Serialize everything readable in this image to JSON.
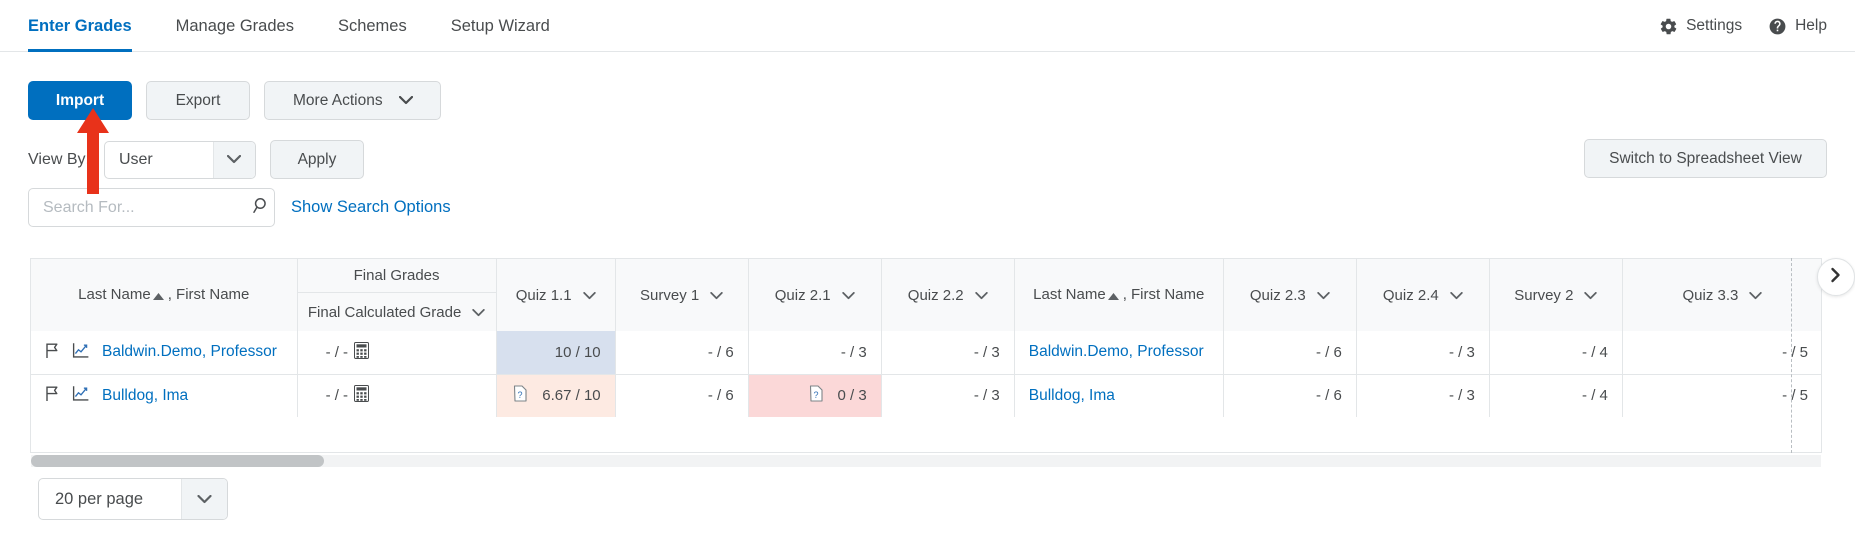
{
  "nav": {
    "tabs": [
      {
        "label": "Enter Grades",
        "active": true
      },
      {
        "label": "Manage Grades",
        "active": false
      },
      {
        "label": "Schemes",
        "active": false
      },
      {
        "label": "Setup Wizard",
        "active": false
      }
    ],
    "settings_label": "Settings",
    "help_label": "Help",
    "settings_icon": "gear-icon",
    "help_icon": "help-circle-icon",
    "active_color": "#006fbf"
  },
  "toolbar": {
    "import_label": "Import",
    "export_label": "Export",
    "more_actions_label": "More Actions",
    "primary_color": "#006fbf"
  },
  "viewby": {
    "label": "View By:",
    "selected": "User",
    "apply_label": "Apply",
    "spreadsheet_label": "Switch to Spreadsheet View"
  },
  "search": {
    "value": "",
    "placeholder": "Search For...",
    "icon": "search-icon",
    "show_options_label": "Show Search Options"
  },
  "table": {
    "group_header": "Final Grades",
    "name_header": "Last Name",
    "name_header_suffix": ", First Name",
    "sort_indicator": "ascending",
    "final_calculated_header": "Final Calculated Grade",
    "columns": [
      {
        "label": "Quiz 1.1",
        "dropdown": true
      },
      {
        "label": "Survey 1",
        "dropdown": true
      },
      {
        "label": "Quiz 2.1",
        "dropdown": true
      },
      {
        "label": "Quiz 2.2",
        "dropdown": true
      },
      {
        "label": "Last Name",
        "dropdown": false,
        "is_name": true,
        "suffix": ", First Name"
      },
      {
        "label": "Quiz 2.3",
        "dropdown": true
      },
      {
        "label": "Quiz 2.4",
        "dropdown": true
      },
      {
        "label": "Survey 2",
        "dropdown": true
      },
      {
        "label": "Quiz 3.3",
        "dropdown": true
      }
    ],
    "rows": [
      {
        "name": "Baldwin.Demo, Professor",
        "final_calculated": "- / -",
        "quiz_1_1": "10 / 10",
        "quiz_1_1_flag": "",
        "survey_1": "- / 6",
        "quiz_2_1": "- / 3",
        "quiz_2_1_flag": "",
        "quiz_2_2": "- / 3",
        "name2": "Baldwin.Demo, Professor",
        "quiz_2_3": "- / 6",
        "quiz_2_4": "- / 3",
        "survey_2": "- / 4",
        "quiz_3_3": "- / 5"
      },
      {
        "name": "Bulldog, Ima",
        "final_calculated": "- / -",
        "quiz_1_1": "6.67 / 10",
        "quiz_1_1_flag": "ungraded-question-icon",
        "survey_1": "- / 6",
        "quiz_2_1": "0 / 3",
        "quiz_2_1_flag": "ungraded-question-icon",
        "quiz_2_2": "- / 3",
        "name2": "Bulldog, Ima",
        "quiz_2_3": "- / 6",
        "quiz_2_4": "- / 3",
        "survey_2": "- / 4",
        "quiz_3_3": "- / 5"
      }
    ],
    "highlight_selected_color": "#d7e0ee",
    "highlight_warn_color": "#fdeae2",
    "highlight_error_color": "#fbd8d8",
    "scroll_right_icon": "chevron-right-icon"
  },
  "footer": {
    "per_page": "20 per page"
  },
  "annotation": {
    "arrow_color": "#e8321a",
    "points_at": "Import"
  }
}
